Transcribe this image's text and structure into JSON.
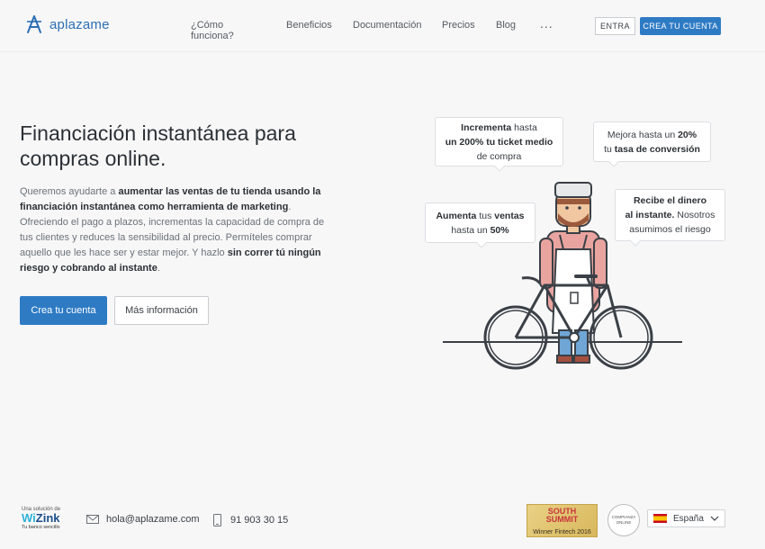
{
  "header": {
    "brand": "aplazame",
    "nav": [
      "¿Cómo funciona?",
      "Beneficios",
      "Documentación",
      "Precios",
      "Blog"
    ],
    "more": "...",
    "login_label": "ENTRA",
    "signup_label": "CREA TU CUENTA"
  },
  "hero": {
    "title": "Financiación instantánea para compras online.",
    "p1": "Queremos ayudarte a ",
    "p1b": "aumentar las ventas de tu tienda usando la financiación instantánea como herramienta de marketing",
    "p2": ". Ofreciendo el pago a plazos, incrementas la capacidad de compra de tus clientes y reduces la sensibilidad al precio. Permíteles comprar aquello que les hace ser y estar mejor. Y hazlo ",
    "p2b": "sin correr tú ningún riesgo y cobrando al instante",
    "p3": ".",
    "primary_label": "Crea tu cuenta",
    "secondary_label": "Más información"
  },
  "bubbles": {
    "b1_bold1": "Incrementa",
    "b1_t1": " hasta",
    "b1_bold2": "un 200% tu ticket medio",
    "b1_t2": "de compra",
    "b2_t1": "Mejora hasta un ",
    "b2_bold1": "20%",
    "b2_t2": "tu ",
    "b2_bold2": "tasa de conversión",
    "b3_bold1": "Aumenta",
    "b3_t1": " tus ",
    "b3_bold2": "ventas",
    "b3_t2": "hasta un ",
    "b3_bold3": "50%",
    "b4_bold1": "Recibe el dinero",
    "b4_bold2": "al instante.",
    "b4_t1": " Nosotros",
    "b4_t2": "asumimos el riesgo"
  },
  "footer": {
    "wizink_small": "Una solución de",
    "wizink_logo_a": "Wi",
    "wizink_logo_b": "Zink",
    "wizink_tag": "Tu banco sencillo",
    "email": "hola@aplazame.com",
    "phone": "91 903 30 15",
    "south1": "SOUTH",
    "south2": "SUMMIT",
    "south_award": "Winner Fintech 2016",
    "confianza1": "COMPIANZA",
    "confianza2": "ONLINE",
    "language": "España"
  }
}
